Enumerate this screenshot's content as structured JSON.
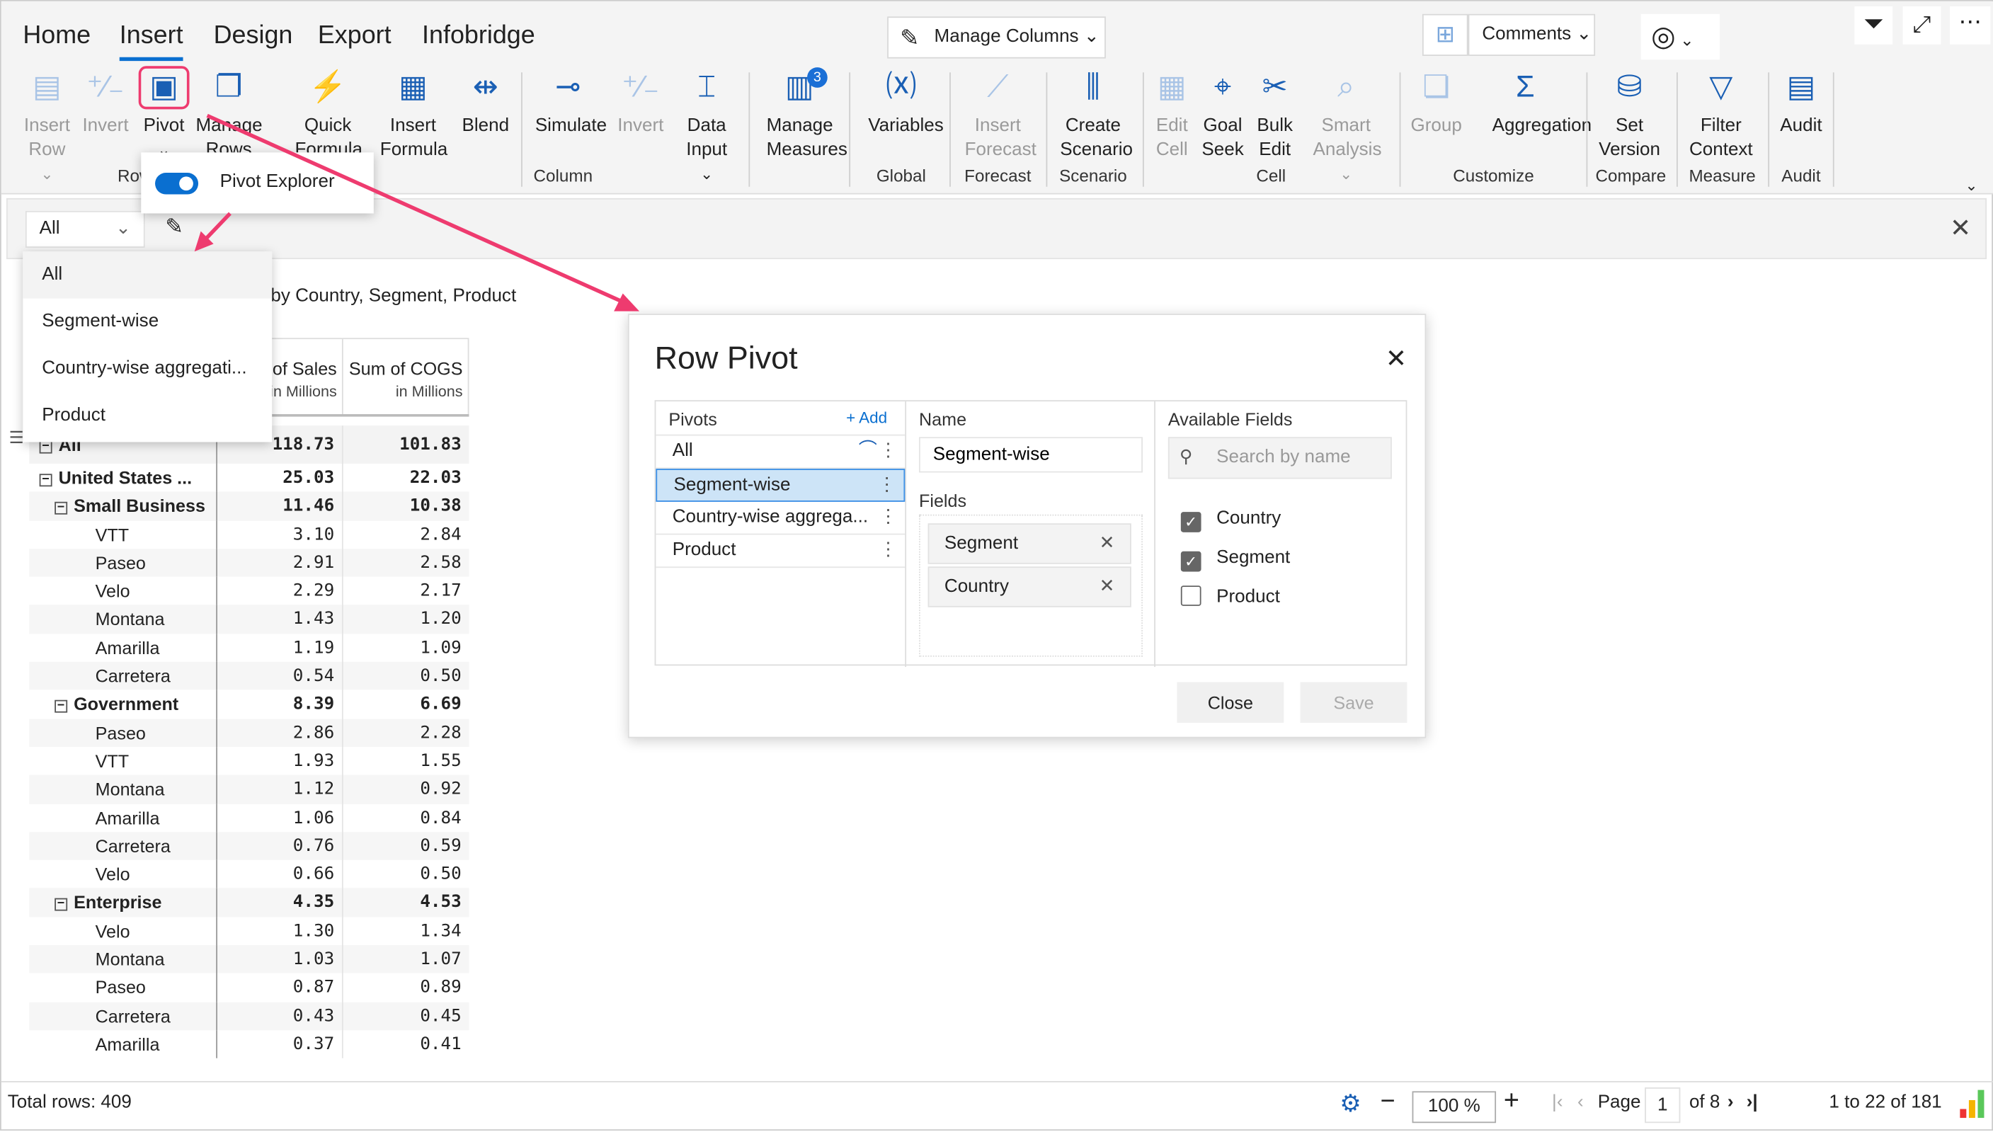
{
  "tabs": [
    "Home",
    "Insert",
    "Design",
    "Export",
    "Infobridge"
  ],
  "active_tab": "Insert",
  "ribbon": {
    "buttons": [
      {
        "label": "Insert Row",
        "icon": "insert-row-icon",
        "glyph": "▤",
        "disabled": true,
        "dropdown": true
      },
      {
        "label": "Invert",
        "icon": "invert-icon",
        "glyph": "⁺∕₋",
        "disabled": true
      },
      {
        "label": "Pivot",
        "icon": "pivot-icon",
        "glyph": "▣",
        "selected": true,
        "dropdown": true
      },
      {
        "label": "Manage Rows",
        "icon": "manage-rows-icon",
        "glyph": "❐"
      },
      {
        "label": "Quick Formula",
        "icon": "lightning-icon",
        "glyph": "⚡",
        "dropdown": true
      },
      {
        "label": "Insert Formula",
        "icon": "calculator-icon",
        "glyph": "▦"
      },
      {
        "label": "Blend",
        "icon": "blend-icon",
        "glyph": "⇹"
      },
      {
        "label": "Simulate",
        "icon": "simulate-icon",
        "glyph": "⊸"
      },
      {
        "label": "Invert",
        "icon": "invert-icon",
        "glyph": "⁺∕₋",
        "disabled": true
      },
      {
        "label": "Data Input",
        "icon": "data-input-icon",
        "glyph": "⌶",
        "dropdown": true
      },
      {
        "label": "Manage Measures",
        "icon": "manage-measures-icon",
        "glyph": "▥",
        "badge": "3"
      },
      {
        "label": "Variables",
        "icon": "variables-icon",
        "glyph": "⒳"
      },
      {
        "label": "Insert Forecast",
        "icon": "forecast-icon",
        "glyph": "⟋",
        "disabled": true
      },
      {
        "label": "Create Scenario",
        "icon": "scenario-icon",
        "glyph": "⫼"
      },
      {
        "label": "Edit Cell",
        "icon": "edit-cell-icon",
        "glyph": "▦",
        "disabled": true
      },
      {
        "label": "Goal Seek",
        "icon": "target-icon",
        "glyph": "⌖"
      },
      {
        "label": "Bulk Edit",
        "icon": "tools-icon",
        "glyph": "✂"
      },
      {
        "label": "Smart Analysis",
        "icon": "smart-analysis-icon",
        "glyph": "⌕",
        "disabled": true,
        "dropdown": true
      },
      {
        "label": "Group",
        "icon": "group-icon",
        "glyph": "❏",
        "disabled": true
      },
      {
        "label": "Aggregation",
        "icon": "sigma-icon",
        "glyph": "Σ"
      },
      {
        "label": "Set Version",
        "icon": "database-gear-icon",
        "glyph": "⛁"
      },
      {
        "label": "Filter Context",
        "icon": "filter-icon",
        "glyph": "▽"
      },
      {
        "label": "Audit",
        "icon": "audit-icon",
        "glyph": "▤"
      }
    ],
    "groups": [
      "Row",
      "Column",
      "Global",
      "Forecast",
      "Scenario",
      "Cell",
      "Customize",
      "Compare",
      "Measure",
      "Audit"
    ]
  },
  "top_right": {
    "manage_columns": "Manage Columns",
    "comments": "Comments"
  },
  "pivot_popover": {
    "label": "Pivot Explorer",
    "toggle_on": true
  },
  "filter": {
    "selected": "All",
    "options": [
      "All",
      "Segment-wise",
      "Country-wise aggregati...",
      "Product"
    ]
  },
  "report": {
    "subtitle": "by Country, Segment, Product",
    "columns": [
      {
        "title": "Sum of Sales",
        "unit": "in Millions"
      },
      {
        "title": "Sum of COGS",
        "unit": "in Millions"
      }
    ],
    "rows": [
      {
        "label": "All",
        "level": 0,
        "bold": true,
        "toggle": true,
        "sales": "118.73",
        "cogs": "101.83"
      },
      {
        "label": "United States ...",
        "level": 0,
        "bold": true,
        "toggle": true,
        "sales": "25.03",
        "cogs": "22.03"
      },
      {
        "label": "Small Business",
        "level": 1,
        "bold": true,
        "toggle": true,
        "sales": "11.46",
        "cogs": "10.38"
      },
      {
        "label": "VTT",
        "level": 2,
        "sales": "3.10",
        "cogs": "2.84"
      },
      {
        "label": "Paseo",
        "level": 2,
        "sales": "2.91",
        "cogs": "2.58"
      },
      {
        "label": "Velo",
        "level": 2,
        "sales": "2.29",
        "cogs": "2.17"
      },
      {
        "label": "Montana",
        "level": 2,
        "sales": "1.43",
        "cogs": "1.20"
      },
      {
        "label": "Amarilla",
        "level": 2,
        "sales": "1.19",
        "cogs": "1.09"
      },
      {
        "label": "Carretera",
        "level": 2,
        "sales": "0.54",
        "cogs": "0.50"
      },
      {
        "label": "Government",
        "level": 1,
        "bold": true,
        "toggle": true,
        "sales": "8.39",
        "cogs": "6.69"
      },
      {
        "label": "Paseo",
        "level": 2,
        "sales": "2.86",
        "cogs": "2.28"
      },
      {
        "label": "VTT",
        "level": 2,
        "sales": "1.93",
        "cogs": "1.55"
      },
      {
        "label": "Montana",
        "level": 2,
        "sales": "1.12",
        "cogs": "0.92"
      },
      {
        "label": "Amarilla",
        "level": 2,
        "sales": "1.06",
        "cogs": "0.84"
      },
      {
        "label": "Carretera",
        "level": 2,
        "sales": "0.76",
        "cogs": "0.59"
      },
      {
        "label": "Velo",
        "level": 2,
        "sales": "0.66",
        "cogs": "0.50"
      },
      {
        "label": "Enterprise",
        "level": 1,
        "bold": true,
        "toggle": true,
        "sales": "4.35",
        "cogs": "4.53"
      },
      {
        "label": "Velo",
        "level": 2,
        "sales": "1.30",
        "cogs": "1.34"
      },
      {
        "label": "Montana",
        "level": 2,
        "sales": "1.03",
        "cogs": "1.07"
      },
      {
        "label": "Paseo",
        "level": 2,
        "sales": "0.87",
        "cogs": "0.89"
      },
      {
        "label": "Carretera",
        "level": 2,
        "sales": "0.43",
        "cogs": "0.45"
      },
      {
        "label": "Amarilla",
        "level": 2,
        "sales": "0.37",
        "cogs": "0.41"
      }
    ]
  },
  "dialog": {
    "title": "Row Pivot",
    "pivots_header": "Pivots",
    "add_label": "+ Add",
    "pivots": [
      {
        "label": "All",
        "visible_icon": true
      },
      {
        "label": "Segment-wise",
        "selected": true
      },
      {
        "label": "Country-wise aggrega..."
      },
      {
        "label": "Product"
      }
    ],
    "name_label": "Name",
    "name_value": "Segment-wise",
    "fields_label": "Fields",
    "fields": [
      "Segment",
      "Country"
    ],
    "available_label": "Available Fields",
    "search_placeholder": "Search by name",
    "available": [
      {
        "label": "Country",
        "checked": true
      },
      {
        "label": "Segment",
        "checked": true
      },
      {
        "label": "Product",
        "checked": false
      }
    ],
    "close_label": "Close",
    "save_label": "Save"
  },
  "footer": {
    "total_rows": "Total rows: 409",
    "zoom": "100 %",
    "page_label": "Page",
    "page": "1",
    "of_pages": "of 8",
    "range": "1 to 22 of 181"
  },
  "colors": {
    "accent": "#0a6fd0",
    "annotation": "#ee3b6f",
    "selected_row": "#cde4f7"
  }
}
